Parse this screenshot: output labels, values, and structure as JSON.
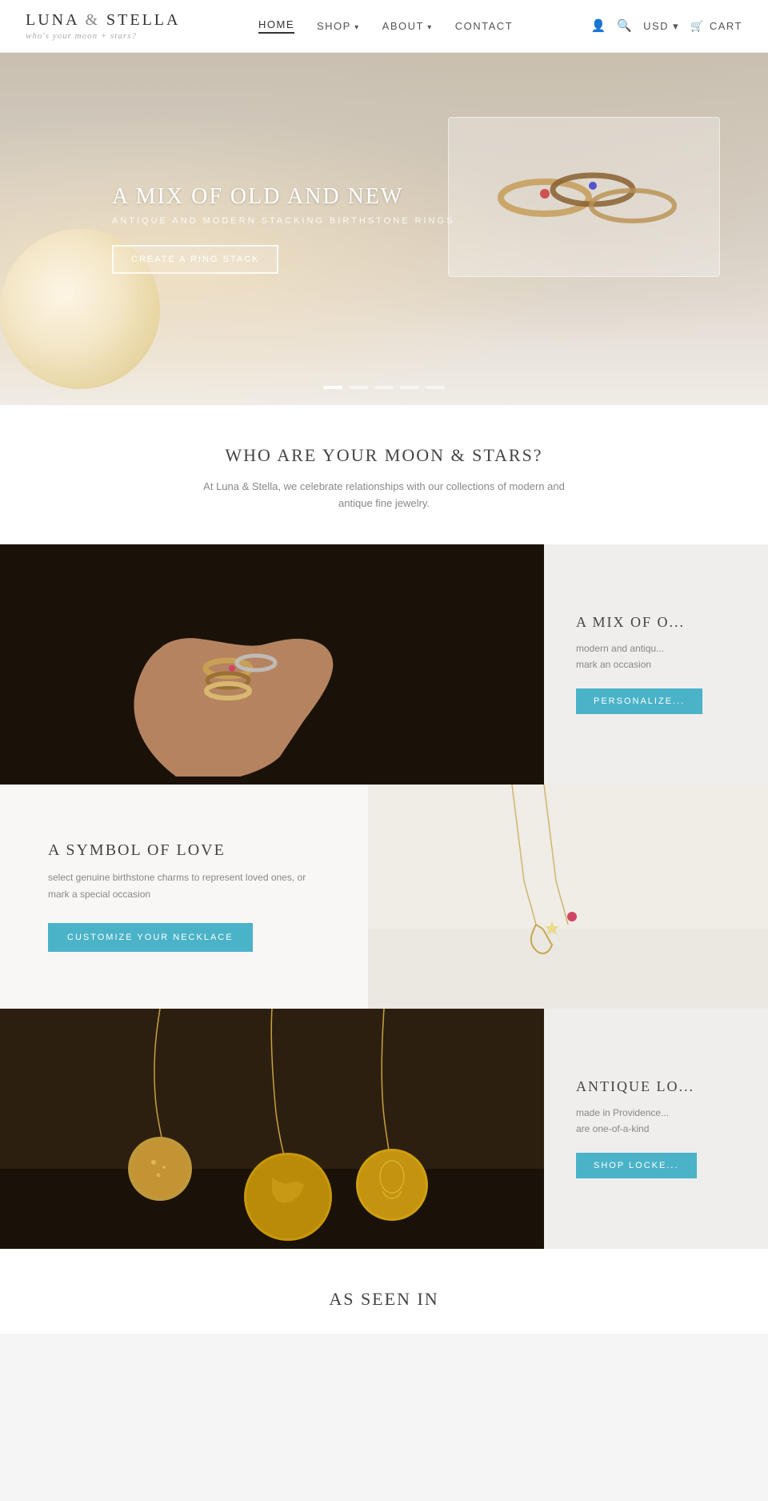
{
  "header": {
    "logo_name": "LUNA & STELLA",
    "logo_tagline": "who's your moon + stars?",
    "nav": [
      {
        "label": "HOME",
        "active": true,
        "has_dropdown": false
      },
      {
        "label": "SHOP",
        "active": false,
        "has_dropdown": true
      },
      {
        "label": "ABOUT",
        "active": false,
        "has_dropdown": true
      },
      {
        "label": "CONTACT",
        "active": false,
        "has_dropdown": false
      }
    ],
    "currency": "USD",
    "cart_label": "CART",
    "currency_arrow": "▾"
  },
  "hero": {
    "title": "A MIX OF OLD AND NEW",
    "subtitle": "ANTIQUE AND MODERN STACKING BIRTHSTONE RINGS",
    "cta_label": "CREATE A RING STACK",
    "dots": [
      true,
      false,
      false,
      false,
      false
    ]
  },
  "moon_stars": {
    "heading": "WHO ARE YOUR MOON & STARS?",
    "subtext": "At Luna & Stella, we celebrate relationships with our collections of modern and antique fine jewelry."
  },
  "mix_old_new": {
    "title": "A MIX OF O...",
    "description": "modern and antiqu... mark an occasion",
    "cta_label": "PERSONALIZE..."
  },
  "symbol_of_love": {
    "title": "A SYMBOL OF LOVE",
    "description": "select genuine birthstone charms to represent loved ones, or mark a special occasion",
    "cta_label": "CUSTOMIZE YOUR NECKLACE"
  },
  "antique_lockets": {
    "title": "ANTIQUE LO...",
    "description": "made in Providence... are one-of-a-kind",
    "cta_label": "SHOP LOCKE..."
  },
  "as_seen_in": {
    "heading": "AS SEEN IN"
  },
  "colors": {
    "accent": "#4ab3c8",
    "text_dark": "#333333",
    "text_medium": "#666666",
    "text_light": "#888888",
    "background_light": "#f8f7f5"
  }
}
